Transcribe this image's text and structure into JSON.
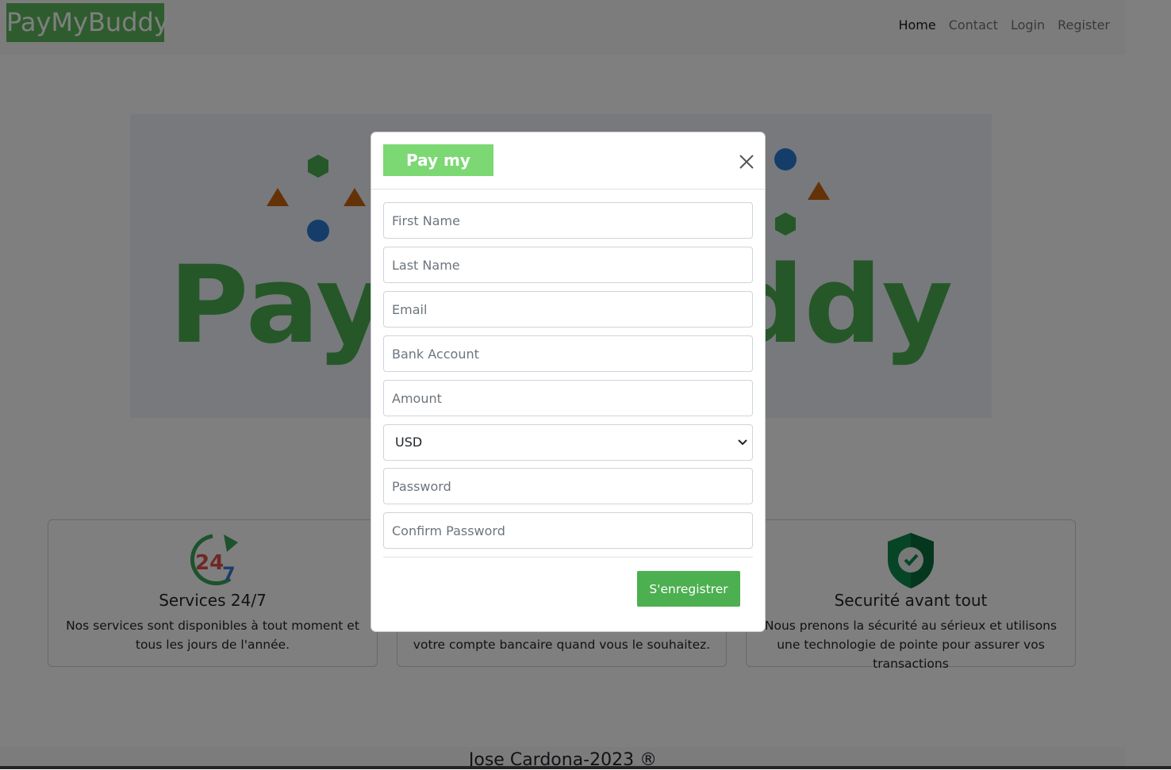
{
  "navbar": {
    "brand": "PayMyBuddy",
    "links": [
      "Home",
      "Contact",
      "Login",
      "Register"
    ]
  },
  "hero": {
    "logo_text": "PayMyBuddy",
    "logo_color": "#5cb85c"
  },
  "cards": [
    {
      "title": "Services 24/7",
      "text": "Nos services sont disponibles à tout moment et tous les jours de l'année.",
      "icon": "clock-24-7-icon"
    },
    {
      "title": "",
      "text": "votre compte bancaire quand vous le souhaitez.",
      "icon": ""
    },
    {
      "title": "Securité avant tout",
      "text": "Nous prenons la sécurité au sérieux et utilisons une technologie de pointe pour assurer vos transactions",
      "icon": "shield-check-icon"
    }
  ],
  "footer": {
    "text": "Jose Cardona-2023  ®"
  },
  "modal": {
    "title": "Pay my buddy",
    "fields": {
      "first_name": "First Name",
      "last_name": "Last Name",
      "email": "Email",
      "bank_account": "Bank Account",
      "amount": "Amount",
      "password": "Password",
      "confirm_password": "Confirm Password"
    },
    "currency": {
      "selected": "USD"
    },
    "submit_label": "S'enregistrer"
  },
  "colors": {
    "brand_green": "#5cb85c",
    "title_green": "#7bd872",
    "button_green": "#4caf50"
  }
}
